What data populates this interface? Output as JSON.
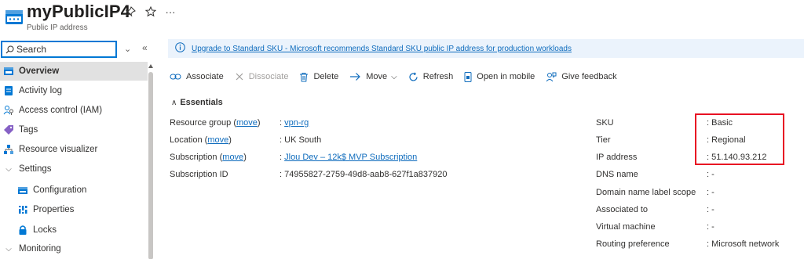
{
  "header": {
    "title": "myPublicIP4",
    "subtitle": "Public IP address",
    "pin_icon": "pin-icon",
    "star_icon": "star-icon",
    "more_label": "···"
  },
  "sidebar": {
    "search": {
      "placeholder": "Search",
      "value": ""
    },
    "collapse_label": "«",
    "expand_label": "⌄",
    "items": [
      {
        "label": "Overview",
        "icon": "overview-icon",
        "selected": true
      },
      {
        "label": "Activity log",
        "icon": "activity-log-icon"
      },
      {
        "label": "Access control (IAM)",
        "icon": "iam-icon"
      },
      {
        "label": "Tags",
        "icon": "tag-icon"
      },
      {
        "label": "Resource visualizer",
        "icon": "resource-visualizer-icon"
      },
      {
        "label": "Settings",
        "icon": "chevron-down-icon",
        "group": true
      },
      {
        "label": "Configuration",
        "icon": "configuration-icon",
        "sub": true
      },
      {
        "label": "Properties",
        "icon": "properties-icon",
        "sub": true
      },
      {
        "label": "Locks",
        "icon": "lock-icon",
        "sub": true
      },
      {
        "label": "Monitoring",
        "icon": "chevron-down-icon",
        "group": true
      }
    ]
  },
  "banner": {
    "text": "Upgrade to Standard SKU - Microsoft recommends Standard SKU public IP address for production workloads"
  },
  "toolbar": {
    "associate": "Associate",
    "dissociate": "Dissociate",
    "delete": "Delete",
    "move": "Move",
    "refresh": "Refresh",
    "open_mobile": "Open in mobile",
    "feedback": "Give feedback"
  },
  "essentials": {
    "title": "Essentials",
    "left": [
      {
        "label": "Resource group",
        "link": "move",
        "value": "vpn-rg",
        "value_link": true
      },
      {
        "label": "Location",
        "link": "move",
        "value": "UK South",
        "value_link": false
      },
      {
        "label": "Subscription",
        "link": "move",
        "value": "Jlou Dev – 12k$ MVP Subscription",
        "value_link": true
      },
      {
        "label": "Subscription ID",
        "link": "",
        "value": "74955827-2759-49d8-aab8-627f1a837920",
        "value_link": false
      }
    ],
    "right": [
      {
        "label": "SKU",
        "value": "Basic"
      },
      {
        "label": "Tier",
        "value": "Regional"
      },
      {
        "label": "IP address",
        "value": "51.140.93.212"
      },
      {
        "label": "DNS name",
        "value": "-"
      },
      {
        "label": "Domain name label scope",
        "value": "-"
      },
      {
        "label": "Associated to",
        "value": "-"
      },
      {
        "label": "Virtual machine",
        "value": "-"
      },
      {
        "label": "Routing preference",
        "value": "Microsoft network"
      }
    ]
  },
  "colors": {
    "accent": "#0078d4",
    "link": "#0f6cbd",
    "highlight": "#e81123",
    "banner_bg": "#ebf3fc"
  }
}
